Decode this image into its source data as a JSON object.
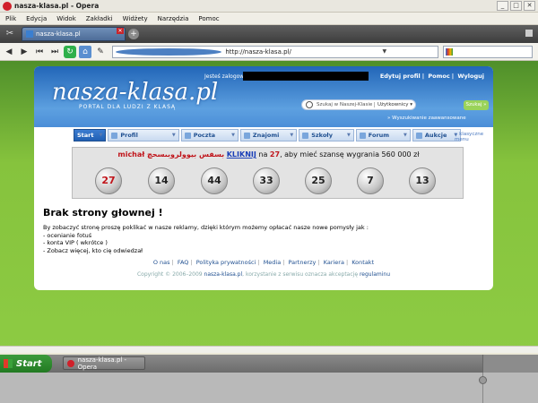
{
  "window": {
    "title": "nasza-klasa.pl - Opera"
  },
  "menu": [
    "Plik",
    "Edycja",
    "Widok",
    "Zakładki",
    "Widżety",
    "Narzędzia",
    "Pomoc"
  ],
  "tab": {
    "label": "nasza-klasa.pl"
  },
  "address": {
    "url": "http://nasza-klasa.pl/"
  },
  "site": {
    "logo": "nasza-klasa.pl",
    "slogan": "PORTAL DLA LUDZI Z KLASĄ",
    "logged_as": "Jesteś zalogowany jako",
    "top_links": [
      "Edytuj profil",
      "Pomoc",
      "Wyloguj"
    ],
    "search_placeholder": "Szukaj w Naszej-Klasie",
    "search_scope": "Użytkownicy ▾",
    "search_button": "Szukaj »",
    "advanced_search": "» Wyszukiwanie zaawansowane",
    "nav": [
      "Start",
      "Profil",
      "Poczta",
      "Znajomi",
      "Szkoły",
      "Forum",
      "Aukcje"
    ],
    "classic_menu": "» klasyczne menu"
  },
  "banner": {
    "name": "michał بسفس بيوولروبىسحچ",
    "link": "KLIKNIJ",
    "mid": " na ",
    "number": "27",
    "rest": ", aby mieć szansę wygrania 560 000 zł",
    "balls": [
      "27",
      "14",
      "44",
      "33",
      "25",
      "7",
      "13"
    ]
  },
  "content": {
    "heading": "Brak strony głownej !",
    "lines": [
      "By zobaczyć stronę proszę poklikać w nasze reklamy, dzięki którym możemy opłacać nasze nowe pomysły jak :",
      "- ocenianie fotuś",
      "- konta VIP ( wkrótce )",
      "- Zobacz więcej, kto cię odwiedzał"
    ]
  },
  "footer": {
    "links": [
      "O nas",
      "FAQ",
      "Polityka prywatności",
      "Media",
      "Partnerzy",
      "Kariera",
      "Kontakt"
    ],
    "copyright_prefix": "Copyright © 2006–2009",
    "copyright_site": "nasza-klasa.pl",
    "copyright_mid": ", korzystanie z serwisu oznacza akceptację",
    "copyright_rules": "regulaminu"
  },
  "taskbar": {
    "start": "Start",
    "item": "nasza-klasa.pl - Opera"
  },
  "colors": {
    "header_blue": "#2266b8",
    "page_green": "#86c33d",
    "banner_red": "#c0141a"
  }
}
